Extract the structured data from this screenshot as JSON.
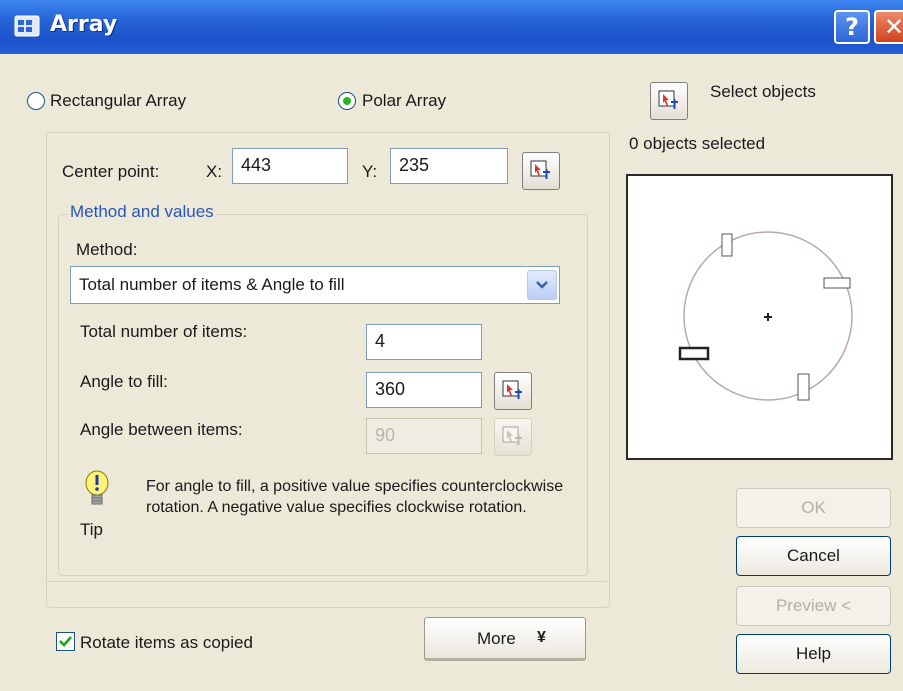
{
  "titlebar": {
    "title": "Array",
    "help_glyph": "?",
    "close_glyph": "✕"
  },
  "array_type": {
    "rectangular_label": "Rectangular Array",
    "polar_label": "Polar Array",
    "selected": "polar"
  },
  "select_objects": {
    "label": "Select objects",
    "status": "0 objects selected"
  },
  "center_point": {
    "label": "Center point:",
    "x_label": "X:",
    "x_value": "443",
    "y_label": "Y:",
    "y_value": "235"
  },
  "method_values": {
    "group_label": "Method and values",
    "method_label": "Method:",
    "method_value": "Total number of items & Angle to fill",
    "total_items_label": "Total number of items:",
    "total_items_value": "4",
    "angle_fill_label": "Angle to fill:",
    "angle_fill_value": "360",
    "angle_between_label": "Angle between items:",
    "angle_between_value": "90"
  },
  "tip": {
    "label": "Tip",
    "text": "For angle to fill, a positive value specifies counterclockwise rotation.  A negative value specifies clockwise rotation."
  },
  "rotate_items": {
    "label": "Rotate items as copied",
    "checked": true
  },
  "buttons": {
    "more": "More",
    "more_chevron": "¥",
    "ok": "OK",
    "cancel": "Cancel",
    "preview": "Preview <",
    "help": "Help"
  },
  "colors": {
    "titlebar": "#2764d8",
    "dialog_bg": "#ece9d8",
    "accent_text": "#2a55b8",
    "radio_dot": "#2bb42b"
  }
}
